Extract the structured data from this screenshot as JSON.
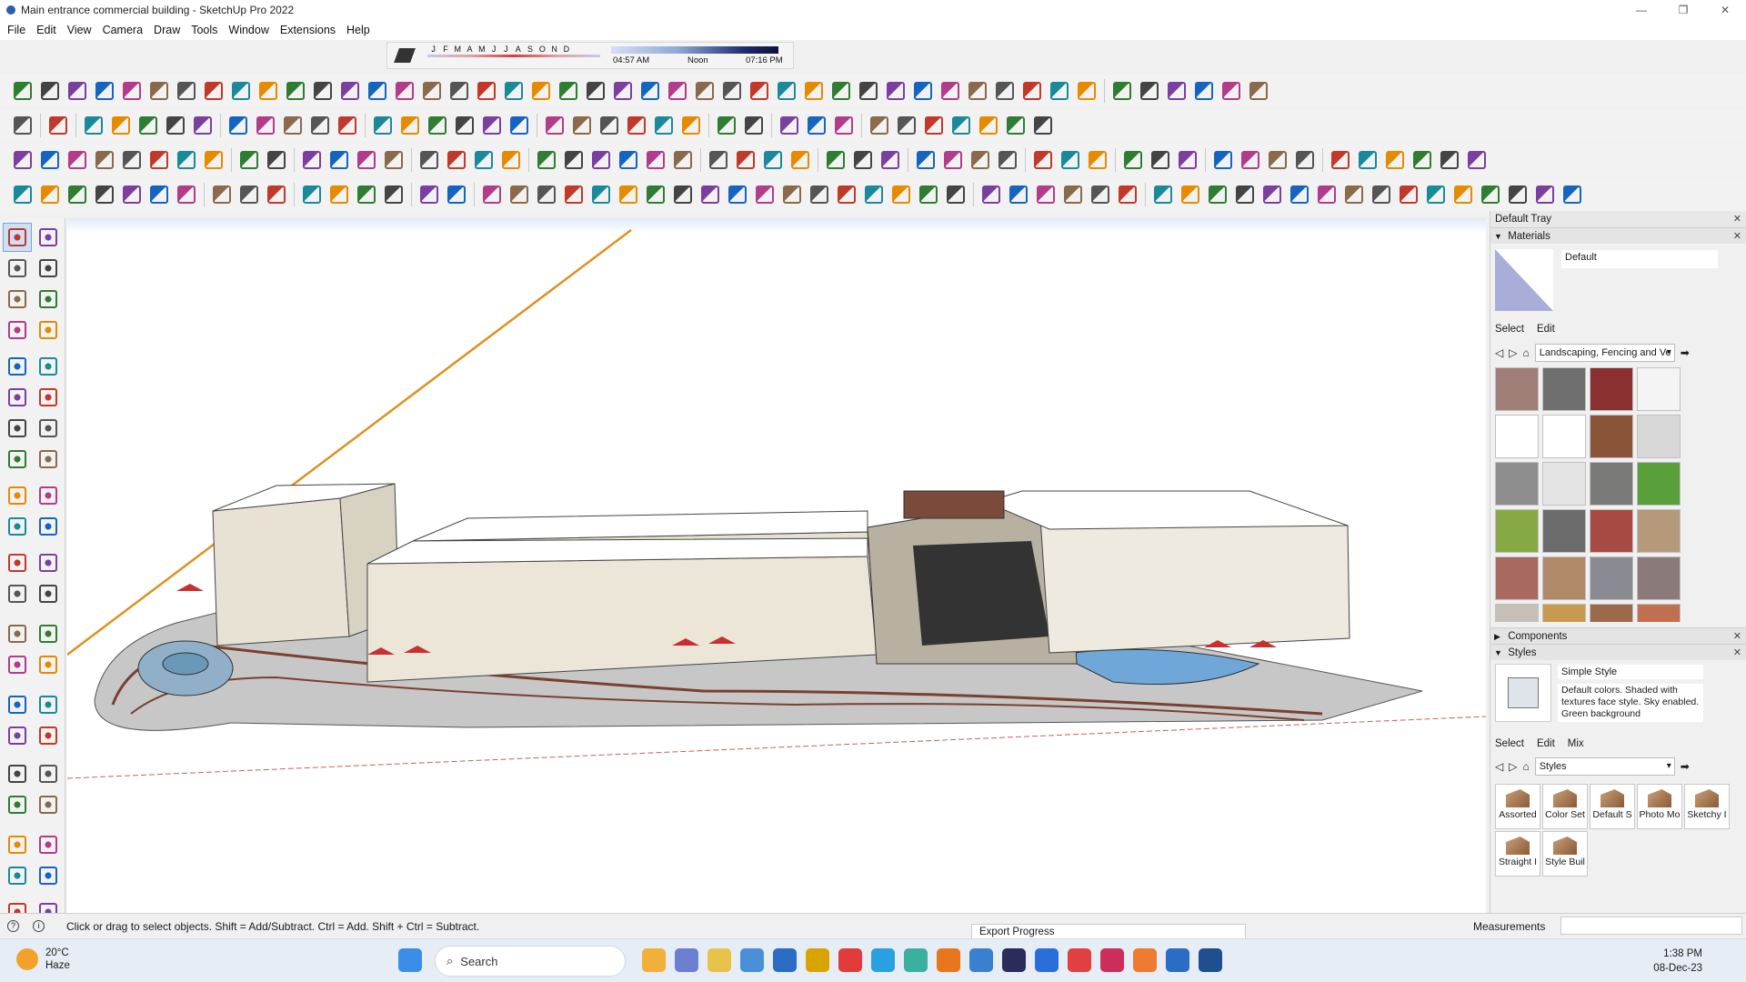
{
  "window": {
    "title": "Main entrance commercial building - SketchUp Pro 2022",
    "controls": [
      "—",
      "❐",
      "✕"
    ]
  },
  "menu": [
    "File",
    "Edit",
    "View",
    "Camera",
    "Draw",
    "Tools",
    "Window",
    "Extensions",
    "Help"
  ],
  "shadows": {
    "months": [
      "J",
      "F",
      "M",
      "A",
      "M",
      "J",
      "J",
      "A",
      "S",
      "O",
      "N",
      "D"
    ],
    "sunrise": "04:57 AM",
    "noon": "Noon",
    "sunset": "07:16 PM"
  },
  "tray": {
    "title": "Default Tray",
    "materials": {
      "title": "Materials",
      "current": "Default",
      "tabs": [
        "Select",
        "Edit"
      ],
      "library": "Landscaping, Fencing and Ve",
      "swatch_colors": [
        "#a07e78",
        "#6f6f70",
        "#8a3030",
        "#f4f4f4",
        "#ffffff",
        "#ffffff",
        "#8a5438",
        "#d8d8d8",
        "#8e8e8e",
        "#e4e4e4",
        "#7a7a78",
        "#5aa03a",
        "#86a845",
        "#6c6c6c",
        "#a84a44",
        "#b49a7a",
        "#a86a60",
        "#b08a68",
        "#8a8a92",
        "#8a7a7a",
        "#c8c0b8",
        "#c89a50",
        "#9a6a4a",
        "#c07050"
      ]
    },
    "components": {
      "title": "Components"
    },
    "styles": {
      "title": "Styles",
      "current_name": "Simple Style",
      "description": "Default colors.  Shaded with textures face style.  Sky enabled.  Green background",
      "tabs": [
        "Select",
        "Edit",
        "Mix"
      ],
      "library": "Styles",
      "folders": [
        "Assorted",
        "Color Set",
        "Default S",
        "Photo Mo",
        "Sketchy I",
        "Straight I",
        "Style Buil"
      ]
    }
  },
  "status": {
    "message": "Click or drag to select objects. Shift = Add/Subtract. Ctrl = Add. Shift + Ctrl = Subtract.",
    "measurements_label": "Measurements",
    "export_popup": "Export Progress"
  },
  "taskbar": {
    "temperature": "20°C",
    "condition": "Haze",
    "search_placeholder": "Search",
    "time": "1:38 PM",
    "date": "08-Dec-23"
  },
  "colors": {
    "accent": "#2b5fa7",
    "sky": "#dfeaf8",
    "sun_line": "#e0901c"
  }
}
